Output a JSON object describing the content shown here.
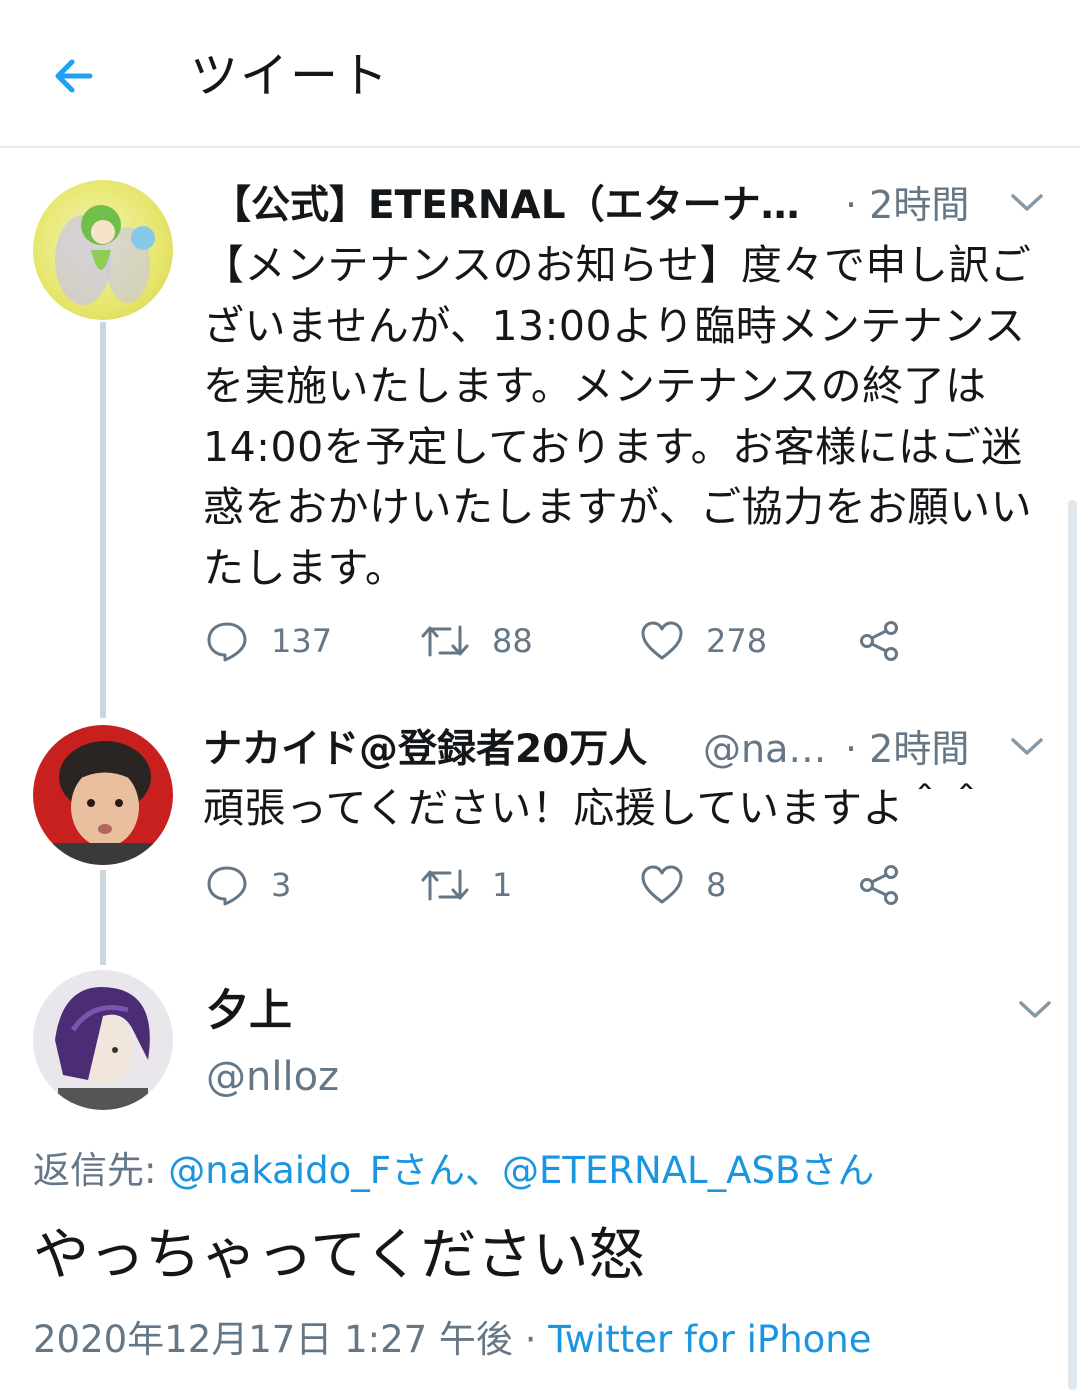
{
  "header": {
    "title": "ツイート",
    "back_icon": "arrow-left-icon"
  },
  "colors": {
    "accent": "#1b95e0",
    "text": "#14171a",
    "secondary": "#657786",
    "divider": "#e6ecf0",
    "thread_line": "#ccd6dd"
  },
  "tweets": [
    {
      "name": "【公式】ETERNAL（エターナ…",
      "handle": "",
      "time": "· 2時間",
      "text": "【メンテナンスのお知らせ】度々で申し訳ございませんが、13:00より臨時メンテナンスを実施いたします。メンテナンスの終了は14:00を予定しております。お客様にはご迷惑をおかけいたしますが、ご協力をお願いいたします。",
      "replies": "137",
      "retweets": "88",
      "likes": "278"
    },
    {
      "name": "ナカイド@登録者20万人",
      "handle": "@na…",
      "time": "· 2時間",
      "text": "頑張ってください！応援していますよ＾＾",
      "replies": "3",
      "retweets": "1",
      "likes": "8"
    }
  ],
  "focused": {
    "name": "夕上",
    "handle": "@nlloz",
    "reply_prefix": "返信先: ",
    "reply_to": "@nakaido_Fさん、@ETERNAL_ASBさん",
    "text": "やっちゃってください怒",
    "timestamp": "2020年12月17日 1:27 午後 · ",
    "source": "Twitter for iPhone"
  }
}
